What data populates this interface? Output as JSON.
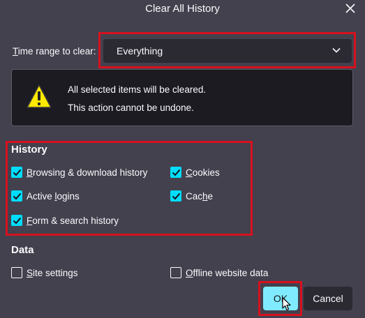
{
  "dialog": {
    "title": "Clear All History",
    "close_icon": "close-icon"
  },
  "time_range": {
    "label_accel": "T",
    "label_rest": "ime range to clear:",
    "selected": "Everything",
    "chevron_icon": "chevron-down-icon"
  },
  "warning": {
    "icon": "warning-icon",
    "line1": "All selected items will be cleared.",
    "line2": "This action cannot be undone."
  },
  "history": {
    "title": "History",
    "items": [
      {
        "pre": "",
        "accel": "B",
        "post": "rowsing & download history",
        "checked": true
      },
      {
        "pre": "",
        "accel": "C",
        "post": "ookies",
        "checked": true
      },
      {
        "pre": "Active ",
        "accel": "l",
        "post": "ogins",
        "checked": true
      },
      {
        "pre": "Cac",
        "accel": "h",
        "post": "e",
        "checked": true
      },
      {
        "pre": "",
        "accel": "F",
        "post": "orm & search history",
        "checked": true
      }
    ]
  },
  "data": {
    "title": "Data",
    "items": [
      {
        "pre": "",
        "accel": "S",
        "post": "ite settings",
        "checked": false
      },
      {
        "pre": "",
        "accel": "O",
        "post": "ffline website data",
        "checked": false
      }
    ]
  },
  "buttons": {
    "ok": "OK",
    "cancel": "Cancel"
  },
  "colors": {
    "background": "#42414d",
    "accent": "#00ddff",
    "highlight": "#d7111f",
    "ok_button": "#80ebff"
  }
}
